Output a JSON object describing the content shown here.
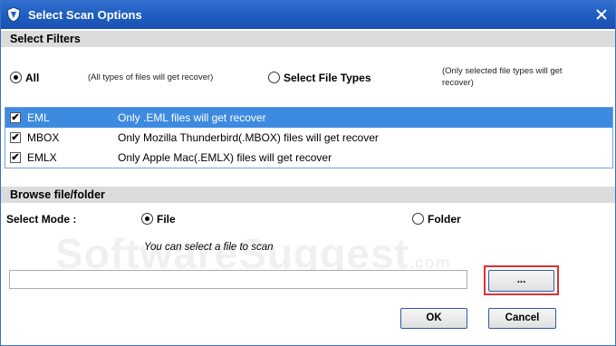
{
  "window": {
    "title": "Select Scan Options"
  },
  "filters": {
    "header": "Select Filters",
    "all_label": "All",
    "all_note": "(All types of files will get recover)",
    "select_label": "Select File Types",
    "select_note_line1": "(Only selected file types will get",
    "select_note_line2": "recover)",
    "selected_mode": "All",
    "file_types": [
      {
        "ext": "EML",
        "desc": "Only .EML files will get recover",
        "checked": true,
        "selected": true
      },
      {
        "ext": "MBOX",
        "desc": "Only Mozilla Thunderbird(.MBOX) files will get recover",
        "checked": true,
        "selected": false
      },
      {
        "ext": "EMLX",
        "desc": "Only Apple Mac(.EMLX) files will get recover",
        "checked": true,
        "selected": false
      }
    ]
  },
  "browse": {
    "header": "Browse file/folder",
    "mode_label": "Select Mode :",
    "file_label": "File",
    "folder_label": "Folder",
    "selected_mode": "File",
    "hint": "You can select a file to scan",
    "path_value": "",
    "browse_button": "..."
  },
  "buttons": {
    "ok": "OK",
    "cancel": "Cancel"
  },
  "watermark": {
    "text": "SoftwareSuggest",
    "suffix": ".com"
  },
  "colors": {
    "titlebar": "#1f5bbf",
    "selection": "#3d8be0",
    "highlight": "#e03131"
  }
}
